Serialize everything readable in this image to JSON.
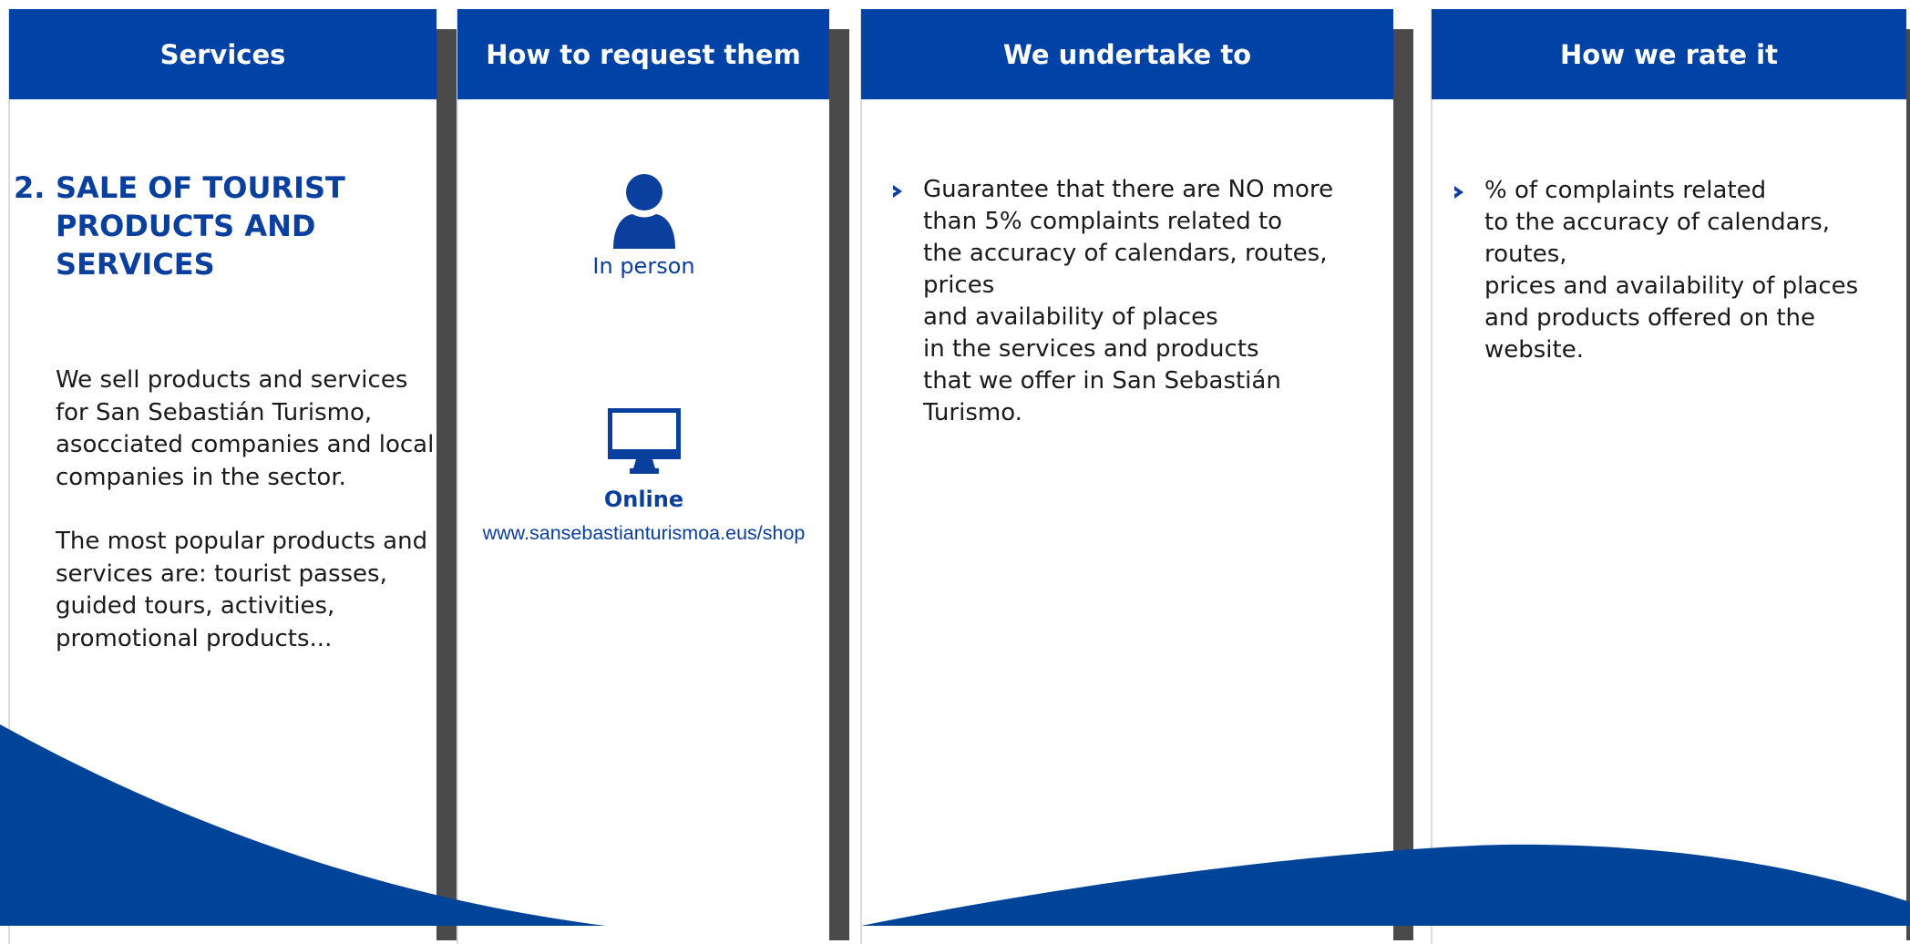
{
  "colors": {
    "brand_blue": "#0042a6",
    "text_blue": "#0a3f9d",
    "shadow_gray": "#4a4a4a"
  },
  "columns": {
    "services": {
      "header": "Services",
      "number": "2.",
      "title": "SALE OF TOURIST PRODUCTS AND SERVICES",
      "paragraph_1": "We sell products and services for San Sebastián Turismo, asocciated companies and local companies in the sector.",
      "paragraph_2": "The most popular products and services are: tourist passes, guided tours, activities, promotional products..."
    },
    "request": {
      "header": "How to request them",
      "in_person": {
        "icon": "person-icon",
        "label": "In person"
      },
      "online": {
        "icon": "monitor-icon",
        "label": "Online",
        "url": "www.sansebastianturismoa.eus/shop"
      }
    },
    "undertake": {
      "header": "We undertake to",
      "bullet_icon": "chevron-right-icon",
      "bullet": "Guarantee that there are NO more\nthan 5% complaints related to\nthe accuracy of calendars, routes, prices\nand availability of places\nin the services and products\nthat we offer in San Sebastián Turismo."
    },
    "rate": {
      "header": "How we rate it",
      "bullet_icon": "chevron-right-icon",
      "bullet": "% of complaints related\nto the accuracy of calendars, routes,\nprices and availability of places\nand products offered on the website."
    }
  }
}
